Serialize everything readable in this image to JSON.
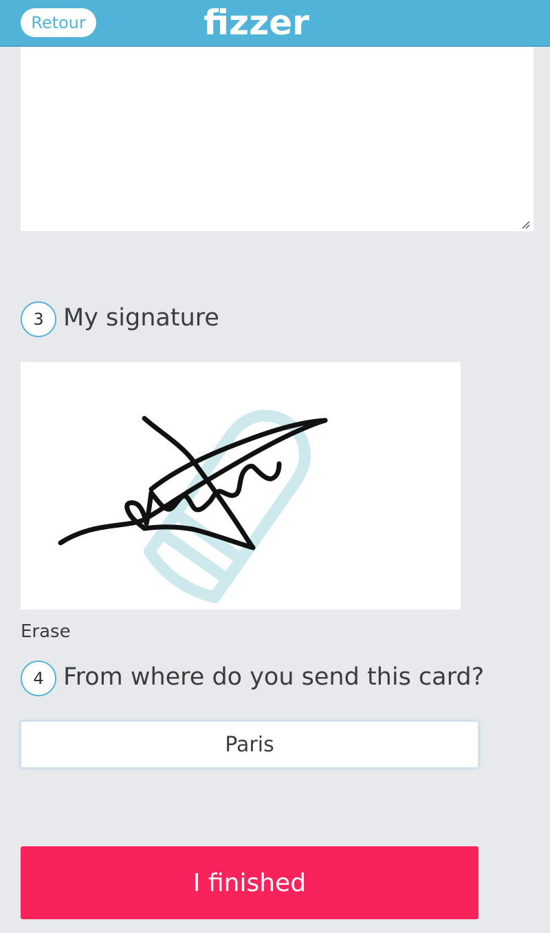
{
  "header": {
    "back_label": "Retour",
    "logo_text": "fizzer",
    "color": "#52b3d9"
  },
  "message": {
    "value": ""
  },
  "signature_step": {
    "number": "3",
    "title": "My signature",
    "erase_label": "Erase"
  },
  "location_step": {
    "number": "4",
    "title": "From where do you send this card?",
    "city_value": "Paris"
  },
  "footer": {
    "finish_label": "I finished",
    "color": "#f7235a"
  },
  "icons": {
    "watermark": "pencil-icon",
    "resize": "resize-grip-icon"
  }
}
